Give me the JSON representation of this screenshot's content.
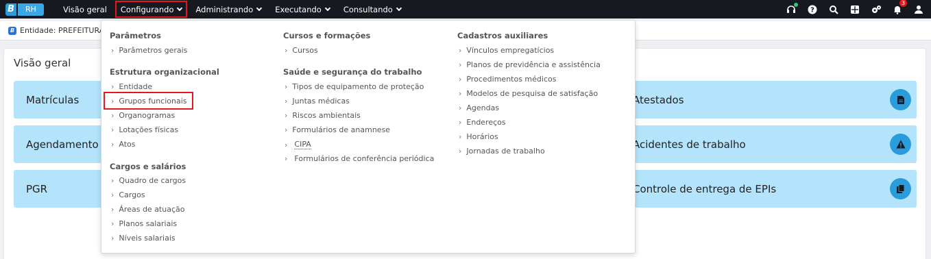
{
  "app": {
    "logo_letter": "B",
    "logo_text": "RH"
  },
  "nav": {
    "visao_geral": "Visão geral",
    "configurando": "Configurando",
    "administrando": "Administrando",
    "executando": "Executando",
    "consultando": "Consultando"
  },
  "notifications_count": "3",
  "entity": {
    "label": "Entidade: PREFEITURA D"
  },
  "panel": {
    "title": "Visão geral",
    "cards_left": [
      "Matrículas",
      "Agendamento",
      "PGR"
    ],
    "cards_right": [
      "Atestados",
      "Acidentes de trabalho",
      "Controle de entrega de EPIs"
    ]
  },
  "menu": {
    "col1": {
      "parametros_title": "Parâmetros",
      "parametros_items": [
        "Parâmetros gerais"
      ],
      "estrutura_title": "Estrutura organizacional",
      "estrutura_items": [
        "Entidade",
        "Grupos funcionais",
        "Organogramas",
        "Lotações físicas",
        "Atos"
      ],
      "cargos_title": "Cargos e salários",
      "cargos_items": [
        "Quadro de cargos",
        "Cargos",
        "Áreas de atuação",
        "Planos salariais",
        "Níveis salariais"
      ]
    },
    "col2": {
      "cursos_title": "Cursos e formações",
      "cursos_items": [
        "Cursos"
      ],
      "saude_title": "Saúde e segurança do trabalho",
      "saude_items": [
        "Tipos de equipamento de proteção",
        "Juntas médicas",
        "Riscos ambientais",
        "Formulários de anamnese",
        "CIPA",
        "Formulários de conferência periódica"
      ]
    },
    "col3": {
      "cadastros_title": "Cadastros auxiliares",
      "cadastros_items": [
        "Vínculos empregatícios",
        "Planos de previdência e assistência",
        "Procedimentos médicos",
        "Modelos de pesquisa de satisfação",
        "Agendas",
        "Endereços",
        "Horários",
        "Jornadas de trabalho"
      ]
    }
  },
  "colors": {
    "topbar": "#16191f",
    "card_bg": "#b3e4fb",
    "accent": "#2a9cdb",
    "highlight": "#e3171c"
  },
  "icons": [
    "headset-icon",
    "help-icon",
    "search-icon",
    "grid-icon",
    "settings-icon",
    "bell-icon",
    "user-icon",
    "document-icon",
    "warning-icon",
    "copy-icon"
  ]
}
